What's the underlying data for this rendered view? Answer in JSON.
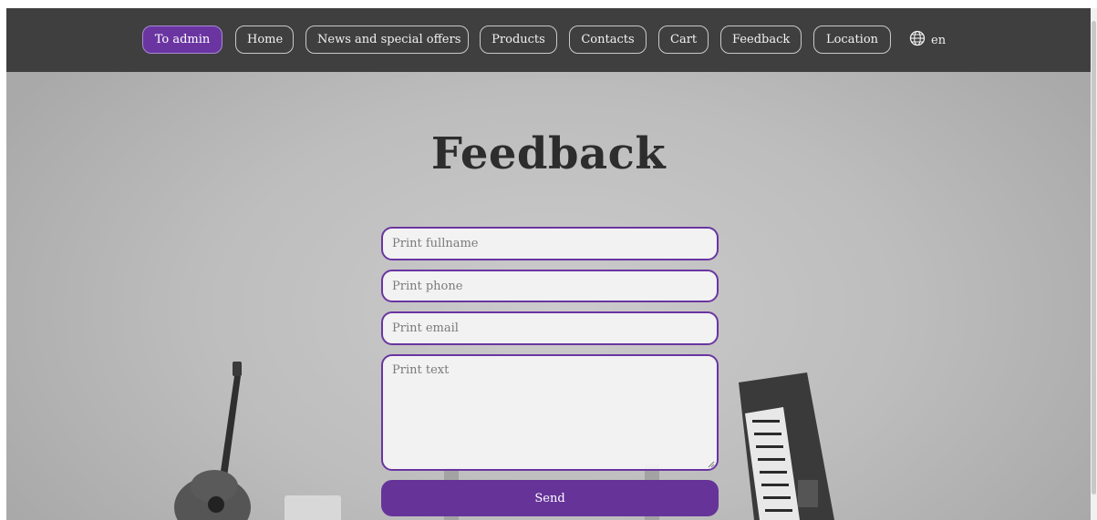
{
  "nav": {
    "items": [
      {
        "label": "To admin",
        "active": true
      },
      {
        "label": "Home"
      },
      {
        "label": "News and special offers"
      },
      {
        "label": "Products"
      },
      {
        "label": "Contacts"
      },
      {
        "label": "Cart"
      },
      {
        "label": "Feedback"
      },
      {
        "label": "Location"
      }
    ],
    "language": {
      "icon": "globe-icon",
      "label": "en"
    }
  },
  "page": {
    "title": "Feedback"
  },
  "form": {
    "fullname_placeholder": "Print fullname",
    "phone_placeholder": "Print phone",
    "email_placeholder": "Print email",
    "text_placeholder": "Print text",
    "send_label": "Send"
  },
  "colors": {
    "accent": "#663399",
    "navbar": "#3f3f3f",
    "background": "#b9b9b9"
  }
}
